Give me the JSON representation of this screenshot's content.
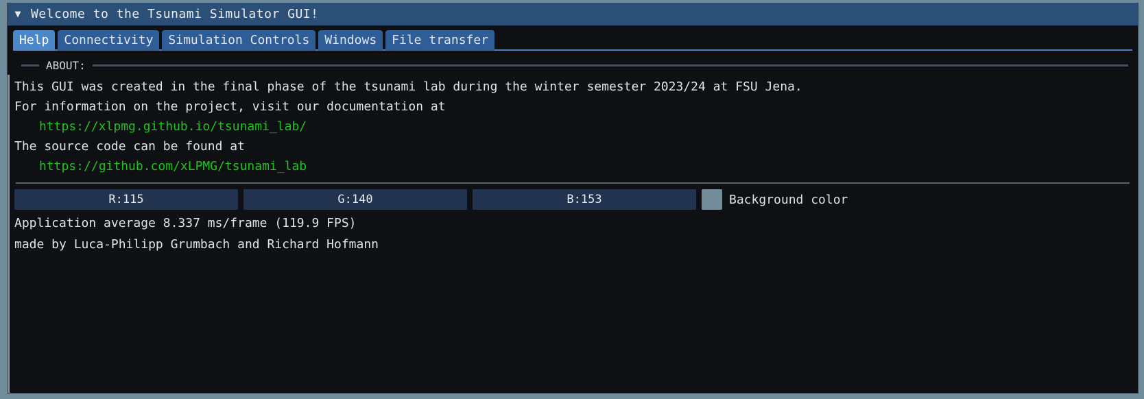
{
  "window": {
    "title": "Welcome to the Tsunami Simulator GUI!",
    "collapse_icon": "▼"
  },
  "tabs": [
    {
      "label": "Help",
      "active": true
    },
    {
      "label": "Connectivity",
      "active": false
    },
    {
      "label": "Simulation Controls",
      "active": false
    },
    {
      "label": "Windows",
      "active": false
    },
    {
      "label": "File transfer",
      "active": false
    }
  ],
  "about": {
    "section_title": "ABOUT:",
    "line1": "This GUI was created in the final phase of the tsunami lab during the winter semester 2023/24 at FSU Jena.",
    "line2": "For information on the project, visit our documentation at",
    "link1": "https://xlpmg.github.io/tsunami_lab/",
    "line3": "The source code can be found at",
    "link2": "https://github.com/xLPMG/tsunami_lab"
  },
  "background_color": {
    "r_label": "R:115",
    "g_label": "G:140",
    "b_label": "B:153",
    "swatch_hex": "#738c99",
    "label": "Background color"
  },
  "status": {
    "performance": "Application average 8.337 ms/frame (119.9 FPS)",
    "credits": "made by Luca-Philipp Grumbach and Richard Hofmann"
  },
  "colors": {
    "window_bg": "#0f1013",
    "title_bar": "#2c4f77",
    "tab_active": "#4c88c9",
    "tab_inactive": "#2f5e96",
    "link_green": "#1cc41c",
    "slider_bg": "#22334f",
    "desktop_bg": "#6e8c99"
  }
}
